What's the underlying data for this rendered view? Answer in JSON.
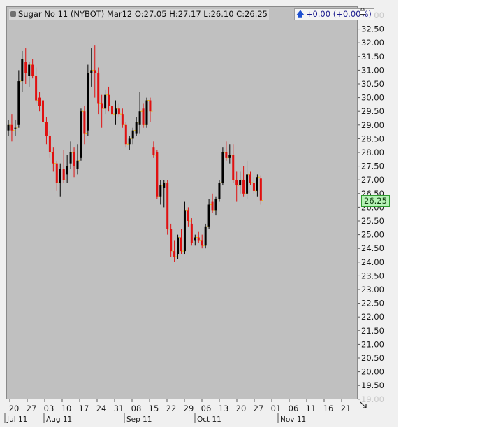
{
  "header": {
    "symbol_label": "Sugar No 11 (NYBOT) Mar12 O:27.05 H:27.17 L:26.10 C:26.25",
    "change_label": "+0.00 (+0.00%)"
  },
  "price_tag": "26.25",
  "icons": {
    "lock": "lock-icon",
    "change_arrow": "up-arrow-icon",
    "resize": "resize-corner-icon"
  },
  "colors": {
    "background": "#c0c0c0",
    "up_candle": "#000000",
    "down_candle": "#e01010",
    "close_tick": "#f5c400",
    "price_tag": "#b6f2b6"
  },
  "chart_data": {
    "type": "candlestick",
    "title": "",
    "ylim": [
      18.9,
      33.3
    ],
    "y_ticks": [
      "33.00",
      "32.50",
      "32.00",
      "31.50",
      "31.00",
      "30.50",
      "30.00",
      "29.50",
      "29.00",
      "28.50",
      "28.00",
      "27.50",
      "27.00",
      "26.50",
      "26.00",
      "25.50",
      "25.00",
      "24.50",
      "24.00",
      "23.50",
      "23.00",
      "22.50",
      "22.00",
      "21.50",
      "21.00",
      "20.50",
      "20.00",
      "19.50",
      "19.00"
    ],
    "x_day_ticks": [
      "20",
      "27",
      "03",
      "10",
      "17",
      "24",
      "31",
      "08",
      "15",
      "22",
      "29",
      "06",
      "13",
      "20",
      "27",
      "01",
      "06",
      "11",
      "16",
      "21"
    ],
    "x_month_ticks": [
      "Jul 11",
      "Aug 11",
      "Sep 11",
      "Oct 11",
      "Nov 11"
    ],
    "candles": [
      {
        "o": 28.8,
        "h": 29.2,
        "l": 28.6,
        "c": 29.0
      },
      {
        "o": 29.0,
        "h": 29.4,
        "l": 28.4,
        "c": 28.8
      },
      {
        "o": 28.9,
        "h": 29.2,
        "l": 28.6,
        "c": 28.9
      },
      {
        "o": 29.0,
        "h": 31.0,
        "l": 28.9,
        "c": 30.6
      },
      {
        "o": 30.6,
        "h": 31.7,
        "l": 30.2,
        "c": 31.4
      },
      {
        "o": 31.3,
        "h": 31.8,
        "l": 30.5,
        "c": 30.9
      },
      {
        "o": 30.8,
        "h": 31.3,
        "l": 30.4,
        "c": 31.2
      },
      {
        "o": 31.2,
        "h": 31.4,
        "l": 30.7,
        "c": 30.8
      },
      {
        "o": 30.8,
        "h": 31.1,
        "l": 29.8,
        "c": 29.9
      },
      {
        "o": 30.0,
        "h": 30.2,
        "l": 29.5,
        "c": 29.7
      },
      {
        "o": 29.9,
        "h": 30.7,
        "l": 28.9,
        "c": 29.1
      },
      {
        "o": 29.1,
        "h": 29.3,
        "l": 28.3,
        "c": 28.6
      },
      {
        "o": 28.6,
        "h": 28.8,
        "l": 27.8,
        "c": 28.0
      },
      {
        "o": 28.0,
        "h": 28.2,
        "l": 27.3,
        "c": 27.6
      },
      {
        "o": 27.6,
        "h": 27.7,
        "l": 26.6,
        "c": 26.9
      },
      {
        "o": 26.9,
        "h": 27.6,
        "l": 26.4,
        "c": 27.4
      },
      {
        "o": 27.4,
        "h": 28.1,
        "l": 26.9,
        "c": 27.0
      },
      {
        "o": 27.2,
        "h": 27.9,
        "l": 26.9,
        "c": 27.5
      },
      {
        "o": 27.6,
        "h": 28.4,
        "l": 27.4,
        "c": 28.0
      },
      {
        "o": 28.0,
        "h": 28.2,
        "l": 27.1,
        "c": 27.5
      },
      {
        "o": 27.4,
        "h": 28.3,
        "l": 27.2,
        "c": 27.7
      },
      {
        "o": 27.8,
        "h": 29.6,
        "l": 27.7,
        "c": 29.5
      },
      {
        "o": 29.5,
        "h": 29.7,
        "l": 28.3,
        "c": 28.7
      },
      {
        "o": 28.8,
        "h": 31.2,
        "l": 28.6,
        "c": 30.9
      },
      {
        "o": 30.9,
        "h": 31.8,
        "l": 30.4,
        "c": 31.0
      },
      {
        "o": 31.0,
        "h": 31.9,
        "l": 30.0,
        "c": 30.9
      },
      {
        "o": 30.9,
        "h": 31.1,
        "l": 29.4,
        "c": 29.8
      },
      {
        "o": 29.8,
        "h": 30.1,
        "l": 28.9,
        "c": 29.6
      },
      {
        "o": 29.6,
        "h": 30.3,
        "l": 29.4,
        "c": 30.1
      },
      {
        "o": 30.1,
        "h": 30.4,
        "l": 29.5,
        "c": 29.7
      },
      {
        "o": 29.7,
        "h": 30.1,
        "l": 29.3,
        "c": 29.4
      },
      {
        "o": 29.4,
        "h": 29.9,
        "l": 29.0,
        "c": 29.6
      },
      {
        "o": 29.6,
        "h": 29.8,
        "l": 29.3,
        "c": 29.4
      },
      {
        "o": 29.4,
        "h": 29.6,
        "l": 28.9,
        "c": 29.0
      },
      {
        "o": 29.0,
        "h": 29.1,
        "l": 28.2,
        "c": 28.3
      },
      {
        "o": 28.3,
        "h": 28.6,
        "l": 28.1,
        "c": 28.5
      },
      {
        "o": 28.5,
        "h": 28.9,
        "l": 28.3,
        "c": 28.8
      },
      {
        "o": 28.7,
        "h": 29.3,
        "l": 28.6,
        "c": 29.1
      },
      {
        "o": 29.0,
        "h": 30.2,
        "l": 28.7,
        "c": 29.5
      },
      {
        "o": 29.6,
        "h": 29.8,
        "l": 28.9,
        "c": 29.0
      },
      {
        "o": 29.0,
        "h": 30.0,
        "l": 28.9,
        "c": 29.9
      },
      {
        "o": 29.9,
        "h": 30.0,
        "l": 29.1,
        "c": 29.5
      },
      {
        "o": 28.2,
        "h": 28.4,
        "l": 27.8,
        "c": 27.9
      },
      {
        "o": 28.0,
        "h": 28.1,
        "l": 26.3,
        "c": 26.4
      },
      {
        "o": 26.4,
        "h": 27.0,
        "l": 26.1,
        "c": 26.8
      },
      {
        "o": 26.7,
        "h": 27.0,
        "l": 26.0,
        "c": 26.9
      },
      {
        "o": 26.9,
        "h": 27.0,
        "l": 25.0,
        "c": 25.2
      },
      {
        "o": 25.2,
        "h": 25.4,
        "l": 24.2,
        "c": 24.4
      },
      {
        "o": 24.4,
        "h": 24.8,
        "l": 24.0,
        "c": 24.2
      },
      {
        "o": 24.3,
        "h": 25.0,
        "l": 24.1,
        "c": 24.9
      },
      {
        "o": 24.9,
        "h": 25.2,
        "l": 24.3,
        "c": 24.4
      },
      {
        "o": 24.4,
        "h": 26.2,
        "l": 24.3,
        "c": 25.9
      },
      {
        "o": 25.9,
        "h": 26.0,
        "l": 25.3,
        "c": 25.5
      },
      {
        "o": 25.4,
        "h": 25.6,
        "l": 24.6,
        "c": 24.7
      },
      {
        "o": 24.8,
        "h": 25.0,
        "l": 24.6,
        "c": 24.9
      },
      {
        "o": 24.9,
        "h": 25.1,
        "l": 24.7,
        "c": 24.8
      },
      {
        "o": 24.8,
        "h": 25.0,
        "l": 24.5,
        "c": 24.6
      },
      {
        "o": 24.6,
        "h": 25.4,
        "l": 24.5,
        "c": 25.3
      },
      {
        "o": 25.3,
        "h": 26.3,
        "l": 25.2,
        "c": 26.1
      },
      {
        "o": 26.2,
        "h": 26.5,
        "l": 25.8,
        "c": 25.9
      },
      {
        "o": 25.9,
        "h": 26.4,
        "l": 25.7,
        "c": 26.3
      },
      {
        "o": 26.3,
        "h": 27.0,
        "l": 26.2,
        "c": 26.9
      },
      {
        "o": 26.9,
        "h": 28.2,
        "l": 26.8,
        "c": 28.0
      },
      {
        "o": 28.0,
        "h": 28.4,
        "l": 27.7,
        "c": 27.8
      },
      {
        "o": 27.8,
        "h": 28.3,
        "l": 27.6,
        "c": 27.9
      },
      {
        "o": 27.9,
        "h": 28.3,
        "l": 26.9,
        "c": 27.0
      },
      {
        "o": 27.0,
        "h": 27.3,
        "l": 26.2,
        "c": 26.8
      },
      {
        "o": 26.8,
        "h": 27.3,
        "l": 26.5,
        "c": 27.0
      },
      {
        "o": 27.0,
        "h": 27.5,
        "l": 26.4,
        "c": 26.5
      },
      {
        "o": 26.5,
        "h": 27.7,
        "l": 26.3,
        "c": 27.2
      },
      {
        "o": 27.2,
        "h": 27.3,
        "l": 26.8,
        "c": 26.9
      },
      {
        "o": 26.9,
        "h": 27.1,
        "l": 26.5,
        "c": 26.6
      },
      {
        "o": 26.6,
        "h": 27.2,
        "l": 26.4,
        "c": 27.1
      },
      {
        "o": 27.05,
        "h": 27.17,
        "l": 26.1,
        "c": 26.25
      }
    ]
  }
}
